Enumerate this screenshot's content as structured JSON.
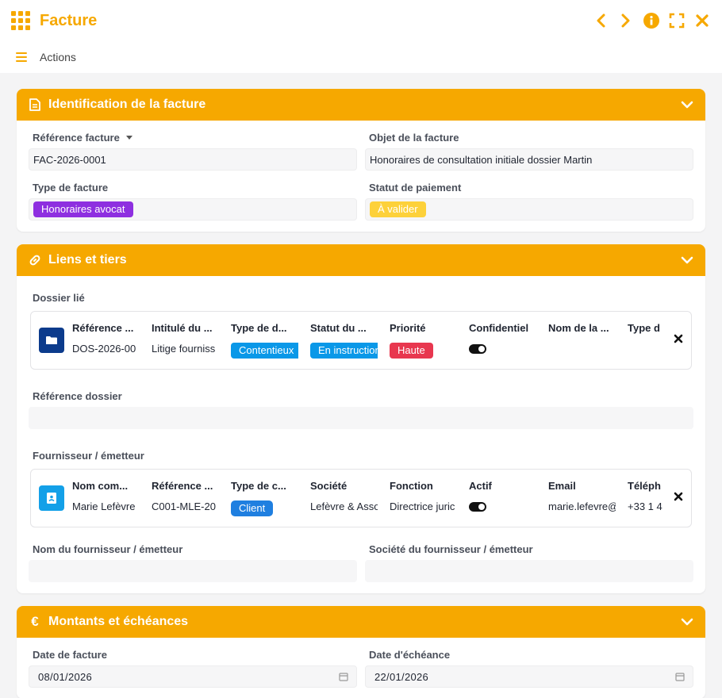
{
  "app": {
    "title": "Facture"
  },
  "toolbar": {
    "actions_label": "Actions"
  },
  "colors": {
    "accent": "#f6a800",
    "purple": "#8e2fe0",
    "yellow": "#fdd13a",
    "blue": "#0a98e8",
    "red": "#e8374f",
    "darkblue": "#0c3b8c",
    "lightblue": "#13a0e8"
  },
  "sections": {
    "identification": {
      "title": "Identification de la facture",
      "reference": {
        "label": "Référence facture",
        "value": "FAC-2026-0001"
      },
      "objet": {
        "label": "Objet de la facture",
        "value": "Honoraires de consultation initiale dossier Martin"
      },
      "type": {
        "label": "Type de facture",
        "value": "Honoraires avocat"
      },
      "statut": {
        "label": "Statut de paiement",
        "value": "À valider"
      }
    },
    "liens": {
      "title": "Liens et tiers",
      "dossier": {
        "label": "Dossier lié",
        "columns": [
          "Référence ...",
          "Intitulé du ...",
          "Type de d...",
          "Statut du ...",
          "Priorité",
          "Confidentiel",
          "Nom de la ...",
          "Type d"
        ],
        "values": {
          "reference": "DOS-2026-00",
          "intitule": "Litige fourniss",
          "type": "Contentieux",
          "statut": "En instruction",
          "priorite": "Haute"
        }
      },
      "reference_dossier": {
        "label": "Référence dossier",
        "value": ""
      },
      "fournisseur": {
        "label": "Fournisseur / émetteur",
        "columns": [
          "Nom com...",
          "Référence ...",
          "Type de c...",
          "Société",
          "Fonction",
          "Actif",
          "Email",
          "Téléph"
        ],
        "values": {
          "nom": "Marie Lefèvre",
          "reference": "C001-MLE-20",
          "type": "Client",
          "societe": "Lefèvre & Asso",
          "fonction": "Directrice juric",
          "email": "marie.lefevre@",
          "telephone": "+33 1 4"
        }
      },
      "nom_fournisseur": {
        "label": "Nom du fournisseur / émetteur",
        "value": ""
      },
      "societe_fournisseur": {
        "label": "Société du fournisseur / émetteur",
        "value": ""
      }
    },
    "montants": {
      "title": "Montants et échéances",
      "date_facture": {
        "label": "Date de facture",
        "value": "08/01/2026"
      },
      "date_echeance": {
        "label": "Date d'échéance",
        "value": "22/01/2026"
      }
    }
  }
}
